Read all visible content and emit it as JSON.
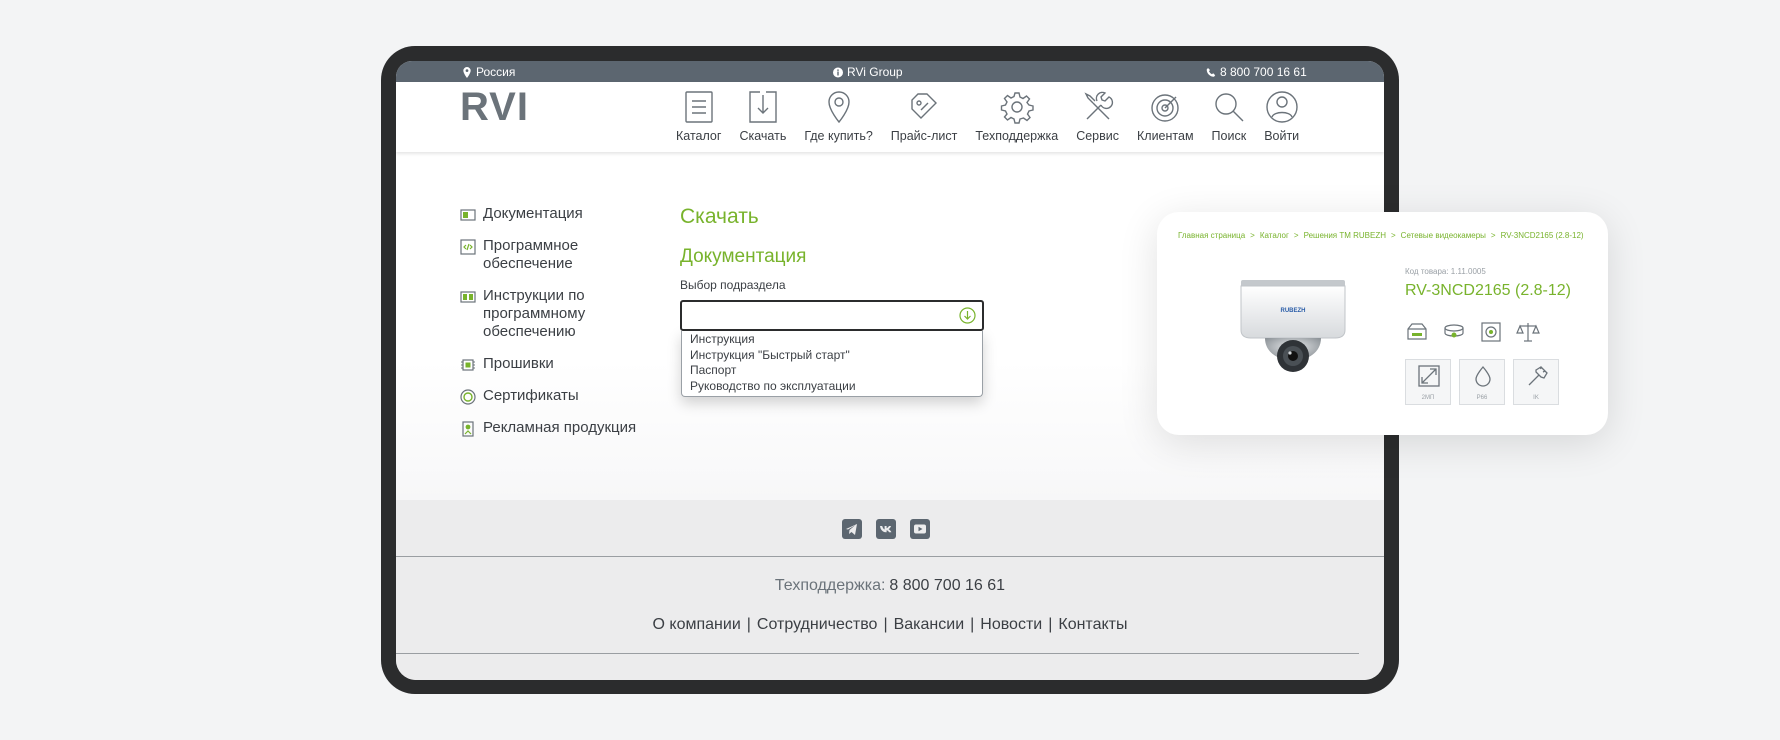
{
  "topbar": {
    "region": "Россия",
    "group": "RVi Group",
    "phone": "8 800 700 16 61"
  },
  "header": {
    "logo": "RVI",
    "nav": [
      {
        "label": "Каталог",
        "icon": "catalog-icon"
      },
      {
        "label": "Скачать",
        "icon": "download-icon"
      },
      {
        "label": "Где купить?",
        "icon": "location-pin-icon"
      },
      {
        "label": "Прайс-лист",
        "icon": "price-tag-icon"
      },
      {
        "label": "Техподдержка",
        "icon": "gear-icon"
      },
      {
        "label": "Сервис",
        "icon": "tools-icon"
      },
      {
        "label": "Клиентам",
        "icon": "target-icon"
      },
      {
        "label": "Поиск",
        "icon": "search-icon"
      },
      {
        "label": "Войти",
        "icon": "user-icon"
      }
    ]
  },
  "sidebar": {
    "items": [
      {
        "label": "Документация",
        "icon": "document-icon"
      },
      {
        "label": "Программное обеспечение",
        "icon": "code-icon"
      },
      {
        "label": "Инструкции по программному обеспечению",
        "icon": "instructions-icon"
      },
      {
        "label": "Прошивки",
        "icon": "chip-icon"
      },
      {
        "label": "Сертификаты",
        "icon": "certificate-icon"
      },
      {
        "label": "Рекламная продукция",
        "icon": "promo-icon"
      }
    ]
  },
  "main": {
    "title": "Скачать",
    "section": "Документация",
    "select_label": "Выбор подраздела",
    "select_value": "",
    "options": [
      "Инструкция",
      "Инструкция \"Быстрый старт\"",
      "Паспорт",
      "Руководство по эксплуатации"
    ]
  },
  "footer": {
    "social": [
      "telegram-icon",
      "vk-icon",
      "youtube-icon"
    ],
    "support_label": "Техподдержка:",
    "support_phone": "8 800 700 16 61",
    "links": [
      "О компании",
      "Сотрудничество",
      "Вакансии",
      "Новости",
      "Контакты"
    ]
  },
  "card": {
    "breadcrumbs": [
      "Главная страница",
      "Каталог",
      "Решения ТМ RUBEZH",
      "Сетевые видеокамеры",
      "RV-3NCD2165 (2.8-12)"
    ],
    "camera_brand": "RUBEZH",
    "code_label": "Код товара: 1.11.0005",
    "product_title": "RV-3NCD2165 (2.8-12)",
    "specs": [
      {
        "label": "2МП",
        "icon": "resolution-icon"
      },
      {
        "label": "P66",
        "icon": "water-drop-icon"
      },
      {
        "label": "IK",
        "icon": "hammer-icon"
      }
    ]
  },
  "colors": {
    "accent": "#78b32c",
    "topbar": "#5c6670",
    "frame": "#2b2c2d",
    "icon": "#6b737a"
  }
}
